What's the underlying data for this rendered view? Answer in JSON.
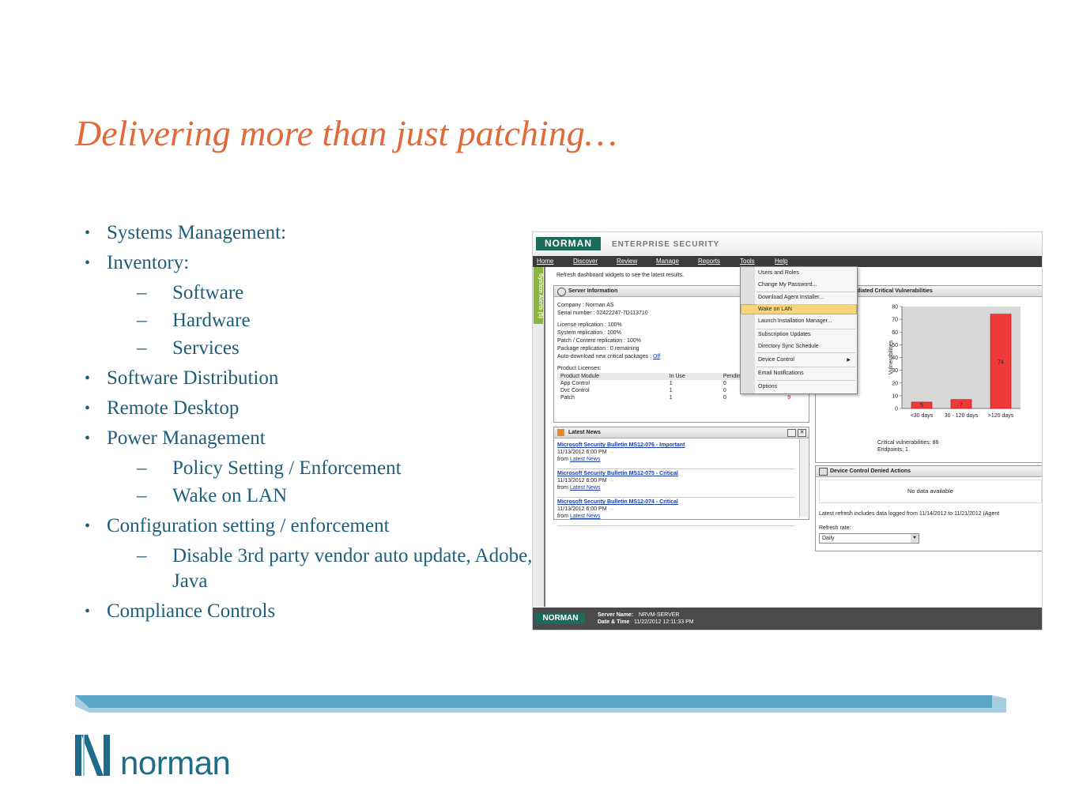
{
  "slide": {
    "title": "Delivering more than just patching…",
    "bullets": [
      {
        "level": 1,
        "text": "Systems Management:"
      },
      {
        "level": 1,
        "text": "Inventory:"
      },
      {
        "level": 2,
        "text": "Software"
      },
      {
        "level": 2,
        "text": "Hardware"
      },
      {
        "level": 2,
        "text": "Services"
      },
      {
        "level": 1,
        "text": "Software Distribution"
      },
      {
        "level": 1,
        "text": "Remote Desktop"
      },
      {
        "level": 1,
        "text": "Power Management"
      },
      {
        "level": 2,
        "text": "Policy Setting / Enforcement"
      },
      {
        "level": 2,
        "text": "Wake on LAN"
      },
      {
        "level": 1,
        "text": "Configuration setting / enforcement"
      },
      {
        "level": 2,
        "text": "Disable 3rd party vendor auto update, Adobe, Java"
      },
      {
        "level": 1,
        "text": "Compliance Controls"
      }
    ],
    "brand": "norman",
    "colors": {
      "title": "#e06a3a",
      "text": "#1f5d7a",
      "stripe": "#5aa7c7"
    }
  },
  "app": {
    "logo": "NORMAN",
    "product": "ENTERPRISE SECURITY",
    "nav": [
      "Home",
      "Discover",
      "Review",
      "Manage",
      "Reports",
      "Tools",
      "Help"
    ],
    "side_tab": "System Alerts (5)",
    "refresh_hint": "Refresh dashboard widgets to see the latest results.",
    "server_info": {
      "title": "Server Information",
      "company": "Company : Norman AS",
      "serial": "Serial number : 02422247-7D113710",
      "license_rep": "License replication : 100%",
      "system_rep": "System replication : 100%",
      "patch_rep": "Patch / Content replication : 100%",
      "package_rep": "Package replication : 0 remaining",
      "auto_download": "Auto-download new critical packages :",
      "auto_download_link": "Off",
      "licenses_label": "Product Licenses:",
      "table_headers": [
        "Product Module",
        "In Use",
        "Pending"
      ],
      "rows": [
        {
          "module": "App Control",
          "in_use": "1",
          "pending": "0",
          "extra": "9"
        },
        {
          "module": "Dvc Control",
          "in_use": "1",
          "pending": "0",
          "extra": "9"
        },
        {
          "module": "Patch",
          "in_use": "1",
          "pending": "0",
          "extra": "9"
        }
      ]
    },
    "news": {
      "title": "Latest News",
      "items": [
        {
          "title": "Microsoft Security Bulletin MS12-076 - Important",
          "date": "11/13/2012 6:00 PM",
          "from": "from",
          "source": "Latest News"
        },
        {
          "title": "Microsoft Security Bulletin MS12-075 - Critical",
          "date": "11/13/2012 6:00 PM",
          "from": "from",
          "source": "Latest News"
        },
        {
          "title": "Microsoft Security Bulletin MS12-074 - Critical",
          "date": "11/13/2012 6:00 PM",
          "from": "from",
          "source": "Latest News"
        }
      ]
    },
    "tools_menu": [
      "Users and Roles",
      "Change My Password...",
      "Download Agent Installer...",
      "Wake on LAN",
      "Launch Installation Manager...",
      "Subscription Updates",
      "Directory Sync Schedule",
      "Device Control",
      "Email Notifications",
      "Options"
    ],
    "vuln_panel": {
      "title": "diated Critical Vulnerabilities",
      "critical": "Critical vulnerabilities: 86",
      "endpoints": "Endpoints: 1"
    },
    "device_panel": {
      "title": "Device Control Denied Actions",
      "empty": "No data available",
      "refresh_note": "Latest refresh includes data logged from 11/14/2012 to 11/21/2012 (Agent",
      "rate_label": "Refresh rate:",
      "rate_value": "Daily"
    },
    "footer": {
      "logo": "NORMAN",
      "server_label": "Server Name:",
      "server_value": "NRVM-SERVER",
      "date_label": "Date & Time",
      "date_value": "11/22/2012 12:11:33 PM"
    }
  },
  "chart_data": {
    "type": "bar",
    "categories": [
      "<30 days",
      "30 - 120 days",
      ">120 days"
    ],
    "values": [
      5,
      7,
      74
    ],
    "ylabel": "Vulnerabilities",
    "xlabel": "",
    "ylim": [
      0,
      80
    ],
    "yticks": [
      0,
      10,
      20,
      30,
      40,
      50,
      60,
      70,
      80
    ],
    "bar_color": "#f03a3a"
  }
}
